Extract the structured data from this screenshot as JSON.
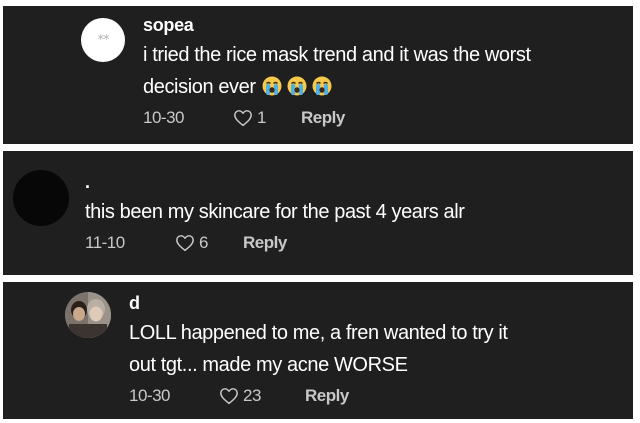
{
  "comments": [
    {
      "username": "sopea",
      "avatar_text": "**",
      "text_lines": [
        "i tried the rice mask trend and it was the worst",
        "decision ever"
      ],
      "emojis": [
        "loudly-crying-face-emoji",
        "loudly-crying-face-emoji",
        "loudly-crying-face-emoji"
      ],
      "date": "10-30",
      "likes": "1",
      "reply_label": "Reply"
    },
    {
      "username": ".",
      "text_lines": [
        "this been my skincare for the past 4 years alr"
      ],
      "date": "11-10",
      "likes": "6",
      "reply_label": "Reply"
    },
    {
      "username": "d",
      "text_lines": [
        "LOLL happened to me, a fren wanted to try it",
        "out tgt... made my acne WORSE"
      ],
      "date": "10-30",
      "likes": "23",
      "reply_label": "Reply"
    }
  ],
  "colors": {
    "card_background": "#1f1f1f",
    "text": "#ffffff",
    "meta_text": "#c8c8c8",
    "emoji_face": "#f6c94a",
    "emoji_tears": "#4fb0e6"
  },
  "icons": {
    "like": "heart-outline-icon"
  }
}
